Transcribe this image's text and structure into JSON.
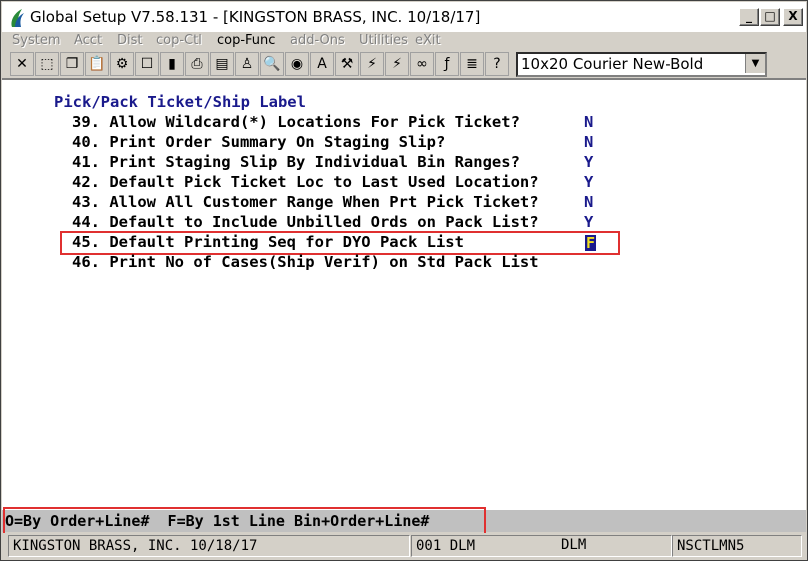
{
  "window": {
    "title": "Global Setup V7.58.131 - [KINGSTON BRASS, INC. 10/18/17]",
    "minimize_label": "_",
    "restore_label": "□",
    "close_label": "X"
  },
  "menu": {
    "items": [
      "System",
      "Acct",
      "Dist",
      "cop-Ctl",
      "cop-Func",
      "add-Ons",
      "Utilities",
      "eXit"
    ]
  },
  "toolbar": {
    "font_select_value": "10x20 Courier New-Bold"
  },
  "main": {
    "section_title": "Pick/Pack Ticket/Ship Label",
    "options": [
      {
        "label": "39. Allow Wildcard(*) Locations For Pick Ticket?",
        "value": "N"
      },
      {
        "label": "40. Print Order Summary On Staging Slip?",
        "value": "N"
      },
      {
        "label": "41. Print Staging Slip By Individual Bin Ranges?",
        "value": "Y"
      },
      {
        "label": "42. Default Pick Ticket Loc to Last Used Location?",
        "value": "Y"
      },
      {
        "label": "43. Allow All Customer Range When Prt Pick Ticket?",
        "value": "N"
      },
      {
        "label": "44. Default to Include Unbilled Ords on Pack List?",
        "value": "Y"
      },
      {
        "label": "45. Default Printing Seq for DYO Pack List",
        "value": "F"
      },
      {
        "label": "46. Print No of Cases(Ship Verif) on Std Pack List",
        "value": ""
      }
    ]
  },
  "hint": {
    "text": "O=By Order+Line#  F=By 1st Line Bin+Order+Line#"
  },
  "status": {
    "company": "KINGSTON BRASS, INC. 10/18/17",
    "code": "001 DLM",
    "user": "DLM",
    "program": "NSCTLMN5"
  }
}
